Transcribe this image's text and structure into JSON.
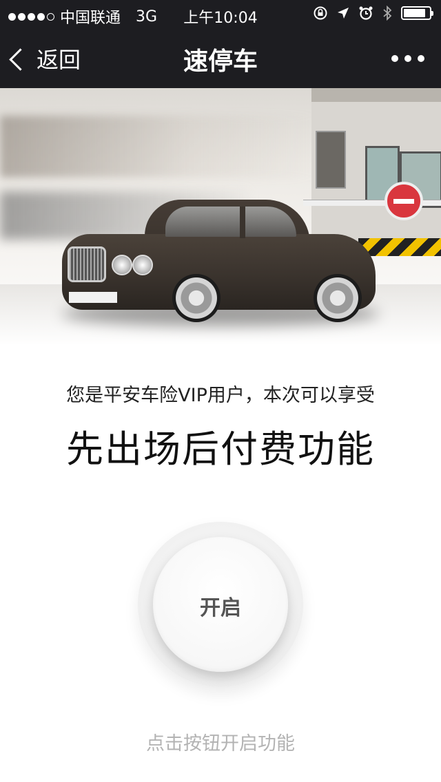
{
  "status_bar": {
    "carrier": "中国联通",
    "network": "3G",
    "time": "上午10:04",
    "signal_bars": 4,
    "signal_total": 5,
    "battery_level": 0.85,
    "icons": [
      "rotation-lock-icon",
      "location-arrow-icon",
      "alarm-icon",
      "bluetooth-icon",
      "battery-icon"
    ]
  },
  "nav": {
    "back_label": "返回",
    "title": "速停车",
    "more_icon": "more-dots-icon"
  },
  "content": {
    "subtitle": "您是平安车险VIP用户，本次可以享受",
    "headline": "先出场后付费功能",
    "button_label": "开启",
    "hint": "点击按钮开启功能"
  },
  "colors": {
    "nav_bg": "#1d1d21",
    "hint": "#b3b3b3",
    "button_text": "#555555"
  }
}
